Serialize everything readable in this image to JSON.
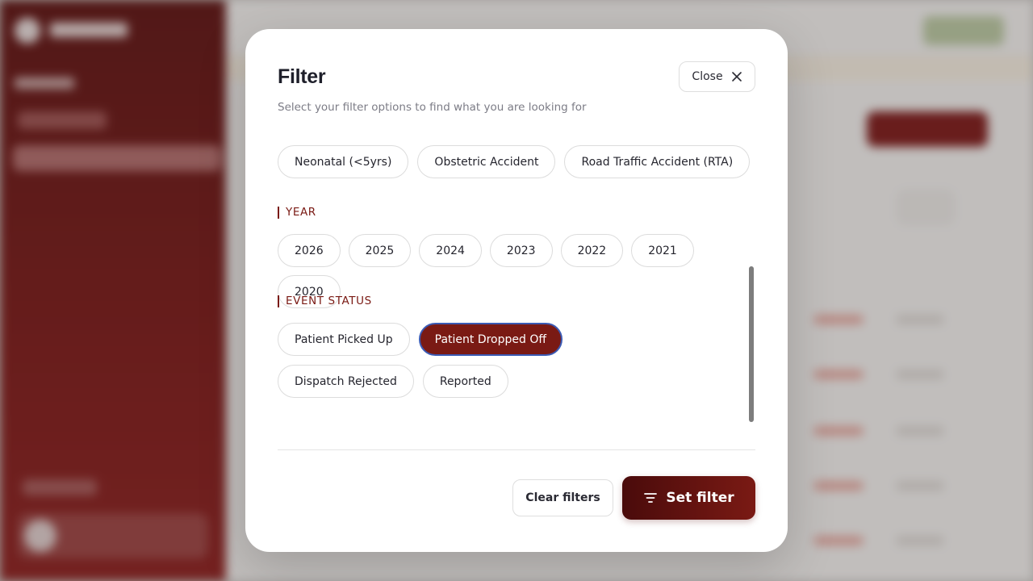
{
  "colors": {
    "accent": "#7a1a14",
    "selected_border": "#3b5bb5",
    "sidebar": "#6a1010"
  },
  "modal": {
    "title": "Filter",
    "subtitle": "Select your filter options to find what you are looking for",
    "close_label": "Close",
    "close_icon": "close-icon"
  },
  "categories": {
    "options": [
      "Neonatal (<5yrs)",
      "Obstetric Accident",
      "Road Traffic Accident (RTA)"
    ]
  },
  "year": {
    "label": "YEAR",
    "options": [
      "2026",
      "2025",
      "2024",
      "2023",
      "2022",
      "2021",
      "2020"
    ]
  },
  "event_status": {
    "label": "EVENT STATUS",
    "options": [
      "Patient Picked Up",
      "Patient Dropped Off",
      "Dispatch Rejected",
      "Reported"
    ],
    "selected": "Patient Dropped Off"
  },
  "footer": {
    "clear_label": "Clear filters",
    "set_label": "Set filter",
    "set_icon": "filter-lines-icon"
  }
}
